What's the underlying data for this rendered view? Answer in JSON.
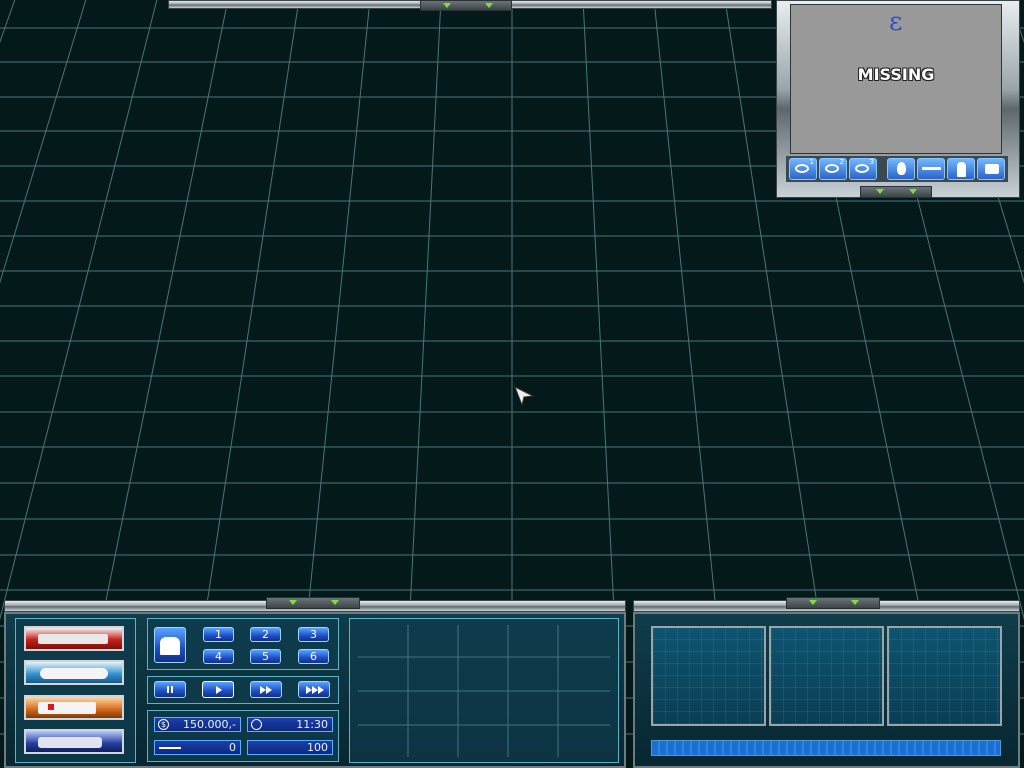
{
  "colors": {
    "world_bg": "#041a1a",
    "grid_line": "#6fa7a6",
    "panel_bg": "#0f3d4a",
    "accent_blue": "#2b64c8",
    "arrow_green": "#7ee03c"
  },
  "top_right_panel": {
    "title_text": "MISSING",
    "logo_glyph": "ε",
    "camera_tabs": [
      {
        "icon": "eye-icon",
        "sup": "1"
      },
      {
        "icon": "eye-icon",
        "sup": "2"
      },
      {
        "icon": "eye-icon",
        "sup": "3"
      }
    ],
    "filter_tabs": [
      {
        "icon": "fire-icon"
      },
      {
        "icon": "stretcher-icon"
      },
      {
        "icon": "person-icon"
      },
      {
        "icon": "vehicle-icon"
      }
    ]
  },
  "vehicles": [
    {
      "icon": "fire-truck-icon",
      "color": "#c8201a"
    },
    {
      "icon": "police-car-icon",
      "color": "#2e8fcc"
    },
    {
      "icon": "ambulance-icon",
      "color": "#d46818"
    },
    {
      "icon": "police-van-icon",
      "color": "#243c9c"
    }
  ],
  "group_buttons": [
    "1",
    "2",
    "3",
    "4",
    "5",
    "6"
  ],
  "speed_buttons": [
    {
      "icon": "pause-icon"
    },
    {
      "icon": "play-icon"
    },
    {
      "icon": "fast-forward-icon"
    },
    {
      "icon": "fastest-forward-icon"
    }
  ],
  "stats": {
    "money": "150.000,-",
    "time": "11:30",
    "injured": "0",
    "score": "100"
  }
}
